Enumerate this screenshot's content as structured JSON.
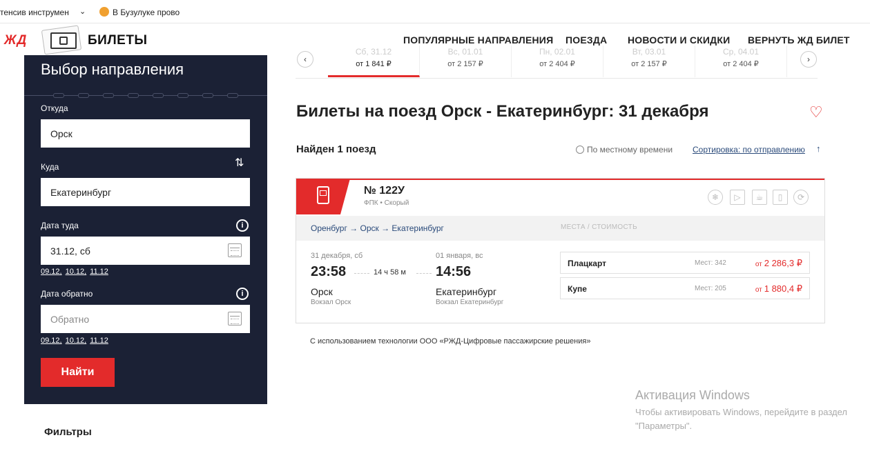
{
  "bookmarks": {
    "item1": "тенсив инструмен",
    "item2": "В Бузулуке прово"
  },
  "header": {
    "logo_zd": "ЖД",
    "logo_text": "БИЛЕТЫ",
    "nav": [
      "ПОПУЛЯРНЫЕ НАПРАВЛЕНИЯ",
      "ПОЕЗДА",
      "НОВОСТИ И СКИДКИ",
      "ВЕРНУТЬ ЖД БИЛЕТ"
    ]
  },
  "sidebar": {
    "title": "Выбор направления",
    "from_label": "Откуда",
    "from_value": "Орск",
    "to_label": "Куда",
    "to_value": "Екатеринбург",
    "date_there_label": "Дата туда",
    "date_there_value": "31.12, сб",
    "date_back_label": "Дата обратно",
    "date_back_placeholder": "Обратно",
    "quick_dates": [
      "09.12,",
      "10.12,",
      "11.12"
    ],
    "find_button": "Найти",
    "filters": "Фильтры"
  },
  "dates_strip": [
    {
      "day": "Сб, 31.12",
      "price": "от 1 841 ₽",
      "active": true
    },
    {
      "day": "Вс, 01.01",
      "price": "от 2 157 ₽",
      "active": false
    },
    {
      "day": "Пн, 02.01",
      "price": "от 2 404 ₽",
      "active": false
    },
    {
      "day": "Вт, 03.01",
      "price": "от 2 157 ₽",
      "active": false
    },
    {
      "day": "Ср, 04.01",
      "price": "от 2 404 ₽",
      "active": false
    }
  ],
  "main": {
    "title": "Билеты на поезд Орск - Екатеринбург: 31 декабря",
    "found": "Найден 1 поезд",
    "local_time": "По местному времени",
    "sort": "Сортировка: по отправлению"
  },
  "train": {
    "number": "№ 122У",
    "subtitle": "ФПК • Скорый",
    "route": "Оренбург → Орск → Екатеринбург",
    "seats_header": "МЕСТА / СТОИМОСТЬ",
    "dep_date": "31 декабря, сб",
    "dep_time": "23:58",
    "duration": "14 ч 58 м",
    "arr_date": "01 января, вс",
    "arr_time": "14:56",
    "dep_city": "Орск",
    "dep_station": "Вокзал Орск",
    "arr_city": "Екатеринбург",
    "arr_station": "Вокзал Екатеринбург",
    "seats": [
      {
        "type": "Плацкарт",
        "count": "Мест: 342",
        "from": "от",
        "price": "2 286,3 ₽"
      },
      {
        "type": "Купе",
        "count": "Мест: 205",
        "from": "от",
        "price": "1 880,4 ₽"
      }
    ]
  },
  "footer": {
    "tech": "С использованием технологии ООО «РЖД-Цифровые пассажирские решения»"
  },
  "windows": {
    "title": "Активация Windows",
    "text": "Чтобы активировать Windows, перейдите в раздел \"Параметры\"."
  }
}
